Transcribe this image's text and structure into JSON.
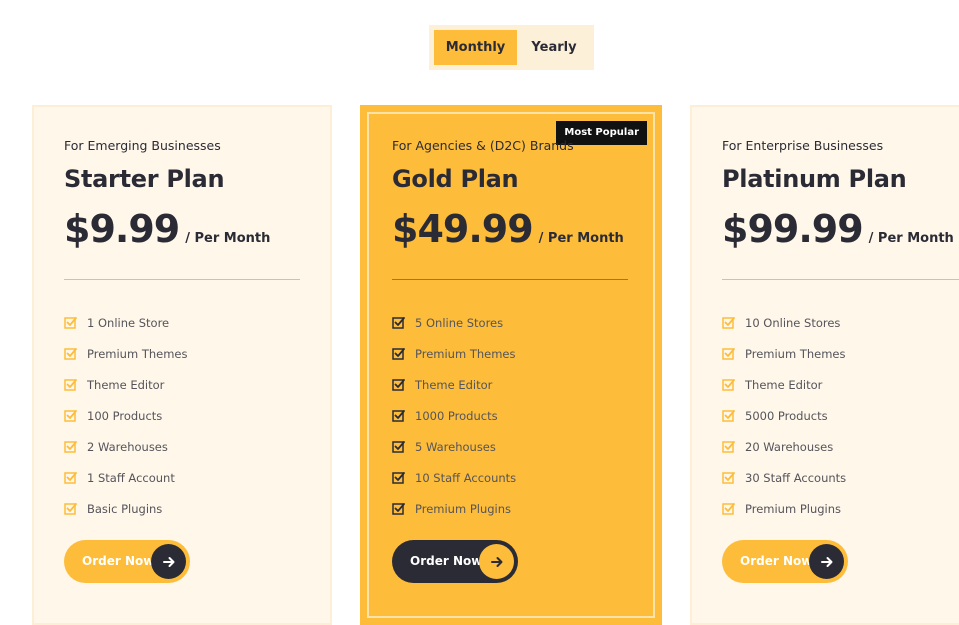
{
  "billing_toggle": {
    "monthly": "Monthly",
    "yearly": "Yearly",
    "selected": "Monthly"
  },
  "colors": {
    "accent": "#fdbd3a",
    "dark": "#2b2b35",
    "card_bg": "#fef7ea",
    "badge_bg": "#111111"
  },
  "plans": [
    {
      "tagline": "For Emerging Businesses",
      "name": "Starter Plan",
      "price": "$9.99",
      "period": "/ Per Month",
      "features": [
        "1 Online Store",
        "Premium Themes",
        "Theme Editor",
        "100 Products",
        "2 Warehouses",
        "1 Staff Account",
        "Basic Plugins"
      ],
      "cta": "Order Now"
    },
    {
      "badge": "Most Popular",
      "tagline": "For Agencies & (D2C) Brands",
      "name": "Gold Plan",
      "price": "$49.99",
      "period": "/ Per Month",
      "features": [
        "5 Online Stores",
        "Premium Themes",
        "Theme Editor",
        "1000 Products",
        "5 Warehouses",
        "10 Staff Accounts",
        "Premium Plugins"
      ],
      "cta": "Order Now"
    },
    {
      "tagline": "For Enterprise Businesses",
      "name": "Platinum Plan",
      "price": "$99.99",
      "period": "/ Per Month",
      "features": [
        "10 Online Stores",
        "Premium Themes",
        "Theme Editor",
        "5000 Products",
        "20 Warehouses",
        "30 Staff Accounts",
        "Premium Plugins"
      ],
      "cta": "Order Now"
    }
  ],
  "icons": {
    "feature": "checkbox-check-icon",
    "cta": "arrow-right-icon"
  }
}
